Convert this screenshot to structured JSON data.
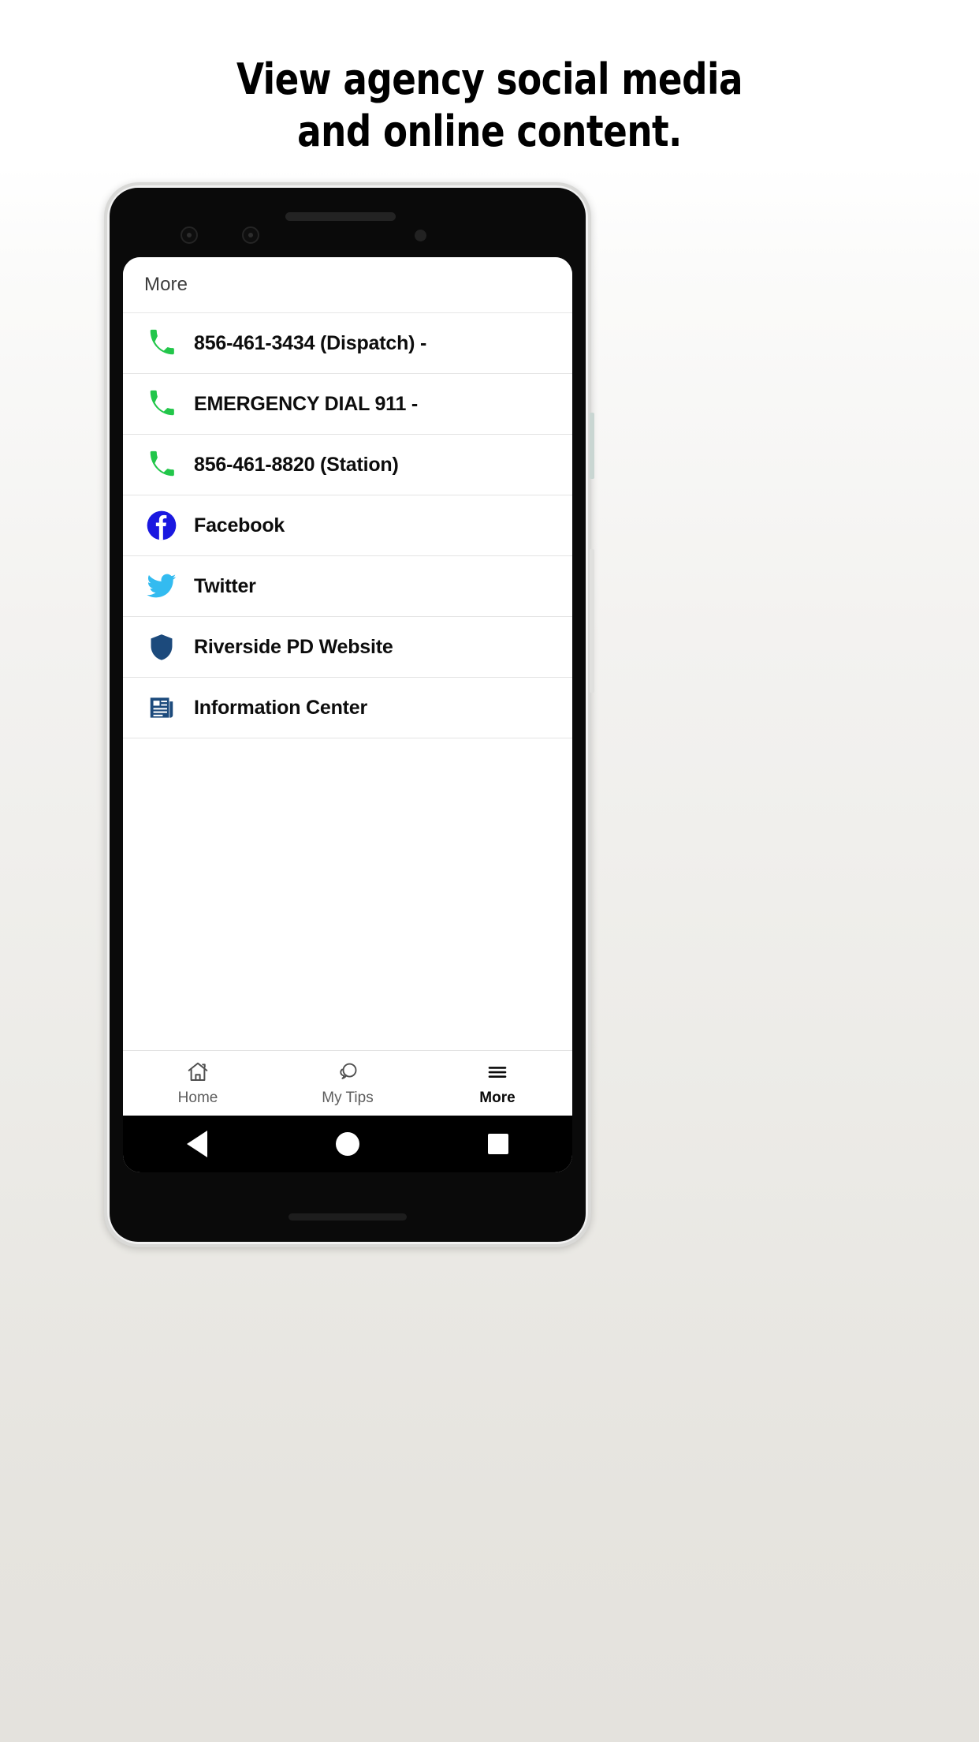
{
  "headline": {
    "line1": "View agency social media",
    "line2": "and online content."
  },
  "colors": {
    "phone_green": "#22c64a",
    "facebook_blue": "#1a18e0",
    "twitter_blue": "#33bbf0",
    "shield_navy": "#1c4a7c",
    "active_tab": "#0a0a0a",
    "inactive_tab": "#5d5d5d"
  },
  "app": {
    "appbar": {
      "title": "More"
    },
    "list": [
      {
        "icon": "phone-icon",
        "label": "856-461-3434 (Dispatch) -"
      },
      {
        "icon": "phone-icon",
        "label": "EMERGENCY DIAL 911 -"
      },
      {
        "icon": "phone-icon",
        "label": "856-461-8820 (Station)"
      },
      {
        "icon": "facebook-icon",
        "label": "Facebook"
      },
      {
        "icon": "twitter-icon",
        "label": "Twitter"
      },
      {
        "icon": "shield-icon",
        "label": "Riverside PD Website"
      },
      {
        "icon": "newspaper-icon",
        "label": "Information Center"
      }
    ],
    "tabs": [
      {
        "icon": "home-icon",
        "label": "Home",
        "active": false
      },
      {
        "icon": "chat-icon",
        "label": "My Tips",
        "active": false
      },
      {
        "icon": "hamburger-icon",
        "label": "More",
        "active": true
      }
    ],
    "android_nav": [
      {
        "icon": "back-triangle-icon"
      },
      {
        "icon": "home-circle-icon"
      },
      {
        "icon": "recents-square-icon"
      }
    ]
  }
}
